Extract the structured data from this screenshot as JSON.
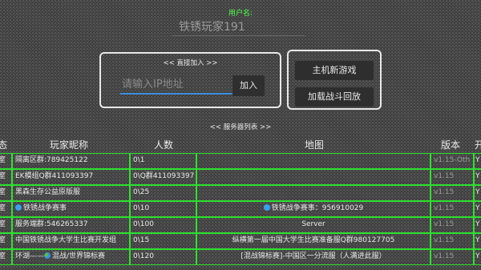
{
  "user": {
    "label": "用户名:",
    "name": "铁锈玩家191"
  },
  "join": {
    "title": "<< 直接加入 >>",
    "placeholder": "请输入IP地址",
    "button": "加入"
  },
  "host": {
    "new_game": "主机新游戏",
    "replay": "加载战斗回放"
  },
  "server_list": {
    "title": "<< 服务器列表 >>",
    "headers": [
      "态",
      "玩家昵称",
      "人数",
      "地图",
      "版本",
      "开"
    ],
    "rows": [
      {
        "status": "室",
        "name": "隔离区群:789425122",
        "players": "0\\1",
        "map": "",
        "version": "v1.15-Oth",
        "open": "Y",
        "icon": ""
      },
      {
        "status": "室",
        "name": "EK模组Q群411093397",
        "players": "0\\Q群411093397",
        "map": "",
        "version": "v1.15",
        "open": "Y",
        "icon": ""
      },
      {
        "status": "室",
        "name": "黑森生存公益原版服",
        "players": "0\\25",
        "map": "",
        "version": "v1.15",
        "open": "Y",
        "icon": ""
      },
      {
        "status": "室",
        "name": "铁锈战争赛事",
        "players": "0\\10",
        "map": "铁锈战争赛事：956910029",
        "version": "v1.15",
        "open": "Y",
        "icon": "globe"
      },
      {
        "status": "室",
        "name": "服务端群:546265337",
        "players": "0\\100",
        "map": "Server",
        "version": "v1.15",
        "open": "Y",
        "icon": ""
      },
      {
        "status": "室",
        "name": "中国铁锈战争大学生比赛开发组",
        "players": "0\\15",
        "map": "纵横第一届中国大学生比赛准备服Q群980127705",
        "version": "v1.15",
        "open": "Y",
        "icon": ""
      },
      {
        "status": "室",
        "name": "环湖——混战/世界锦标赛",
        "players": "0\\120",
        "map": "[混战锦标赛]-中国区一分流服（人满进此服）",
        "version": "v1.15",
        "open": "Y",
        "icon": "earth"
      }
    ]
  },
  "colors": {
    "grid_border": "#2ee12e",
    "label_green": "#4cff4c",
    "input_underline": "#3b8ede"
  }
}
